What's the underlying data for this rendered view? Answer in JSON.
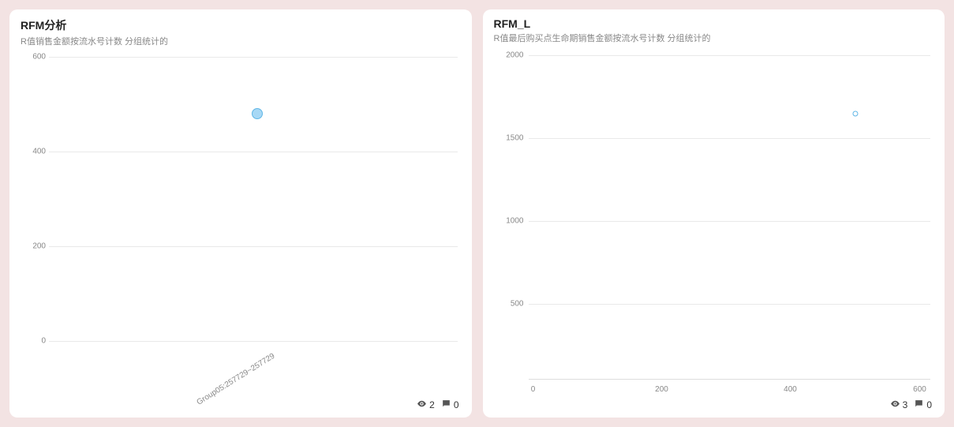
{
  "cards": [
    {
      "title": "RFM分析",
      "subtitle": "R值销售金额按流水号计数 分组统计的",
      "views": "2",
      "comments": "0"
    },
    {
      "title": "RFM_L",
      "subtitle": "R值最后购买点生命期销售金额按流水号计数 分组统计的",
      "views": "3",
      "comments": "0"
    }
  ],
  "chart_data": [
    {
      "type": "scatter",
      "title": "RFM分析",
      "subtitle": "R值销售金额按流水号计数 分组统计的",
      "xlabel": "",
      "ylabel": "",
      "ylim": [
        0,
        600
      ],
      "y_ticks": [
        0,
        200,
        400,
        600
      ],
      "x_categories": [
        "Group05:257729~257729"
      ],
      "series": [
        {
          "name": "Group05:257729~257729",
          "x_index": 0,
          "y": 480
        }
      ],
      "bubble_size": "medium"
    },
    {
      "type": "scatter",
      "title": "RFM_L",
      "subtitle": "R值最后购买点生命期销售金额按流水号计数 分组统计的",
      "xlabel": "",
      "ylabel": "",
      "ylim": [
        0,
        2000
      ],
      "y_ticks": [
        500,
        1000,
        1500,
        2000
      ],
      "xlim": [
        0,
        600
      ],
      "x_ticks": [
        0,
        200,
        400,
        600
      ],
      "series": [
        {
          "x": 500,
          "y": 1650
        }
      ],
      "bubble_size": "small"
    }
  ]
}
